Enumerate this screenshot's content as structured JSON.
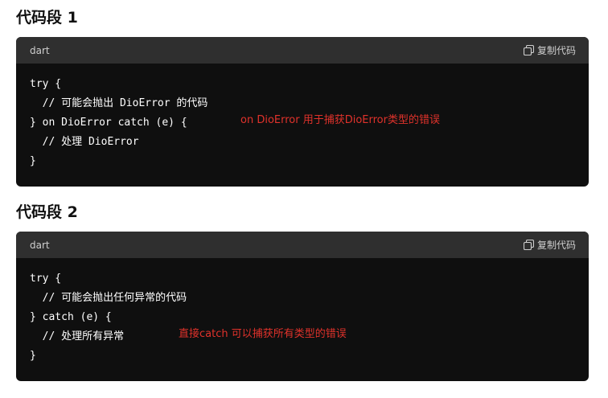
{
  "snippets": [
    {
      "title": "代码段 1",
      "language": "dart",
      "copy_label": "复制代码",
      "copy_icon": "copy-icon",
      "lines": [
        "try {",
        "  // 可能会抛出 DioError 的代码",
        "} on DioError catch (e) {",
        "  // 处理 DioError",
        "}"
      ],
      "annotation": "on DioError 用于捕获DioError类型的错误"
    },
    {
      "title": "代码段 2",
      "language": "dart",
      "copy_label": "复制代码",
      "copy_icon": "copy-icon",
      "lines": [
        "try {",
        "  // 可能会抛出任何异常的代码",
        "} catch (e) {",
        "  // 处理所有异常",
        "}"
      ],
      "annotation": "直接catch 可以捕获所有类型的错误"
    }
  ],
  "colors": {
    "header_bg": "#2f2f2f",
    "code_bg": "#0f0f0f",
    "annotation": "#e0322b"
  }
}
